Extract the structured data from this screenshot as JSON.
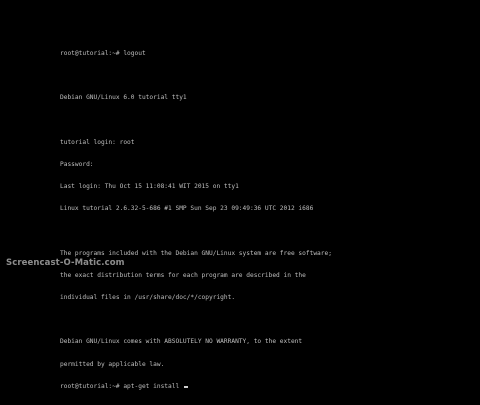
{
  "terminal": {
    "lines": [
      "root@tutorial:~# logout",
      "",
      "Debian GNU/Linux 6.0 tutorial tty1",
      "",
      "tutorial login: root",
      "Password:",
      "Last login: Thu Oct 15 11:08:41 WIT 2015 on tty1",
      "Linux tutorial 2.6.32-5-686 #1 SMP Sun Sep 23 09:49:36 UTC 2012 i686",
      "",
      "The programs included with the Debian GNU/Linux system are free software;",
      "the exact distribution terms for each program are described in the",
      "individual files in /usr/share/doc/*/copyright.",
      "",
      "Debian GNU/Linux comes with ABSOLUTELY NO WARRANTY, to the extent",
      "permitted by applicable law."
    ],
    "prompt_line": "root@tutorial:~# apt-get install "
  },
  "watermark": {
    "text": "Screencast-O-Matic.com"
  }
}
